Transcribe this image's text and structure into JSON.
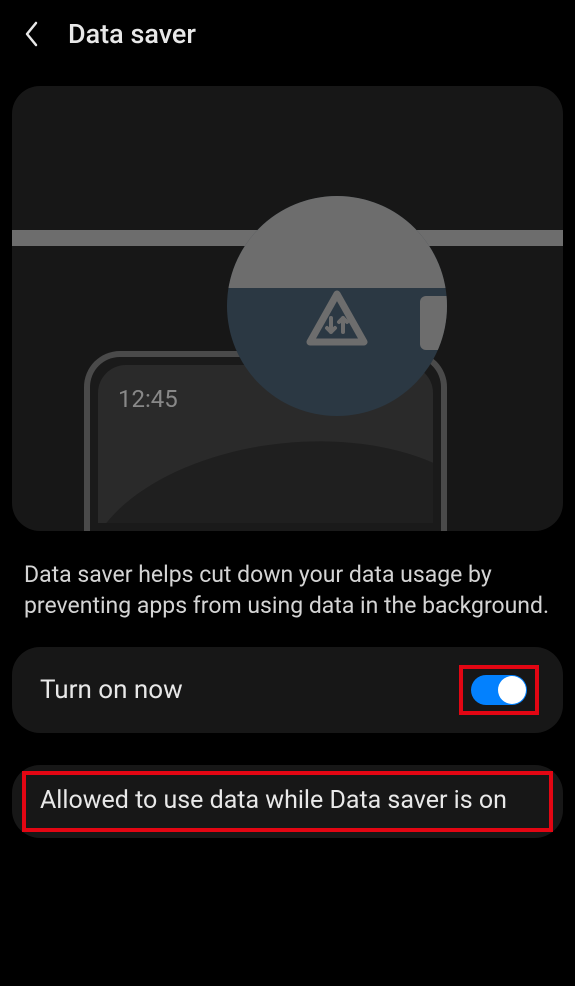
{
  "header": {
    "title": "Data saver"
  },
  "illustration": {
    "phone_time": "12:45"
  },
  "description": "Data saver helps cut down your data usage by preventing apps from using data in the background.",
  "toggle_row": {
    "label": "Turn on now",
    "enabled": true
  },
  "allowed_row": {
    "label": "Allowed to use data while Data saver is on"
  }
}
